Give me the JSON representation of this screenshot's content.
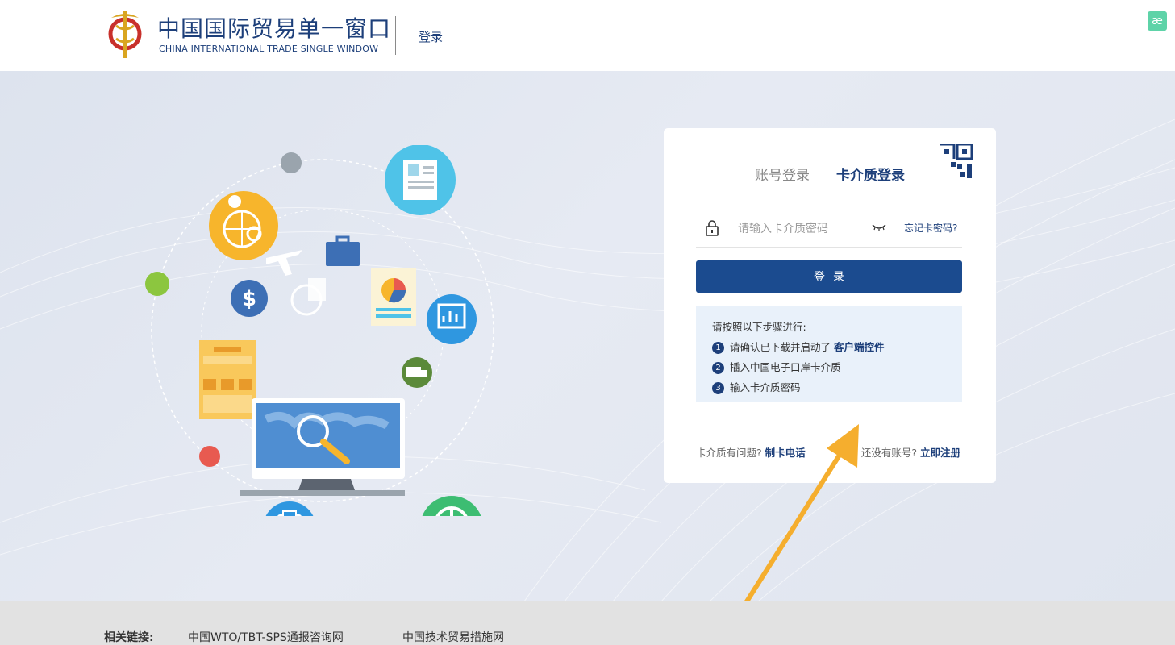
{
  "header": {
    "logo_cn": "中国国际贸易单一窗口",
    "logo_en": "CHINA INTERNATIONAL TRADE SINGLE WINDOW",
    "login_link": "登录",
    "ext_icon_text": "æ"
  },
  "login_card": {
    "tabs": [
      {
        "label": "账号登录",
        "active": false
      },
      {
        "label": "卡介质登录",
        "active": true
      }
    ],
    "password_placeholder": "请输入卡介质密码",
    "forgot_link": "忘记卡密码?",
    "login_button": "登录",
    "steps_title": "请按照以下步骤进行:",
    "steps": [
      {
        "num": "1",
        "text": "请确认已下载并启动了",
        "link": "客户端控件"
      },
      {
        "num": "2",
        "text": "插入中国电子口岸卡介质",
        "link": ""
      },
      {
        "num": "3",
        "text": "输入卡介质密码",
        "link": ""
      }
    ],
    "footer_left_text": "卡介质有问题?",
    "footer_left_link": "制卡电话",
    "footer_right_text": "还没有账号?",
    "footer_right_link": "立即注册"
  },
  "footer": {
    "label": "相关链接:",
    "links": [
      "中国WTO/TBT-SPS通报咨询网",
      "中国技术贸易措施网"
    ]
  },
  "colors": {
    "brand": "#1d3f7a",
    "button": "#1b4b8f",
    "steps_bg": "#e9f1fa",
    "annotation_arrow": "#f5ae2e"
  }
}
